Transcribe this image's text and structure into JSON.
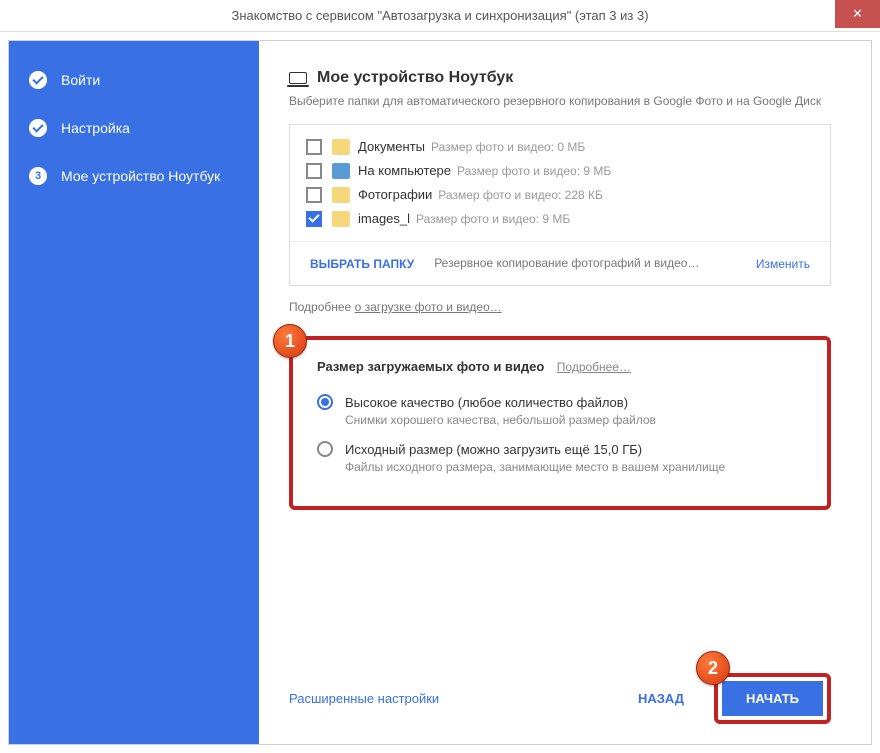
{
  "titlebar": {
    "text": "Знакомство с сервисом \"Автозагрузка и синхронизация\" (этап 3 из 3)",
    "close": "✕"
  },
  "sidebar": {
    "items": [
      {
        "label": "Войти",
        "type": "check"
      },
      {
        "label": "Настройка",
        "type": "check"
      },
      {
        "label": "Мое устройство Ноутбук",
        "type": "step",
        "num": "3"
      }
    ]
  },
  "main": {
    "device_title": "Мое устройство Ноутбук",
    "device_sub": "Выберите папки для автоматического резервного копирования в Google Фото и на Google Диск",
    "folders": [
      {
        "name": "Документы",
        "size": "Размер фото и видео: 0 МБ",
        "checked": false,
        "icon": "folder"
      },
      {
        "name": "На компьютере",
        "size": "Размер фото и видео: 9 МБ",
        "checked": false,
        "icon": "pc"
      },
      {
        "name": "Фотографии",
        "size": "Размер фото и видео: 228 КБ",
        "checked": false,
        "icon": "folder"
      },
      {
        "name": "images_l",
        "size": "Размер фото и видео: 9 МБ",
        "checked": true,
        "icon": "folder"
      }
    ],
    "choose_folder": "ВЫБРАТЬ ПАПКУ",
    "backup_text": "Резервное копирование фотографий и видео…",
    "change": "Изменить",
    "more_prefix": "Подробнее ",
    "more_link": "о загрузке фото и видео…"
  },
  "quality": {
    "title": "Размер загружаемых фото и видео",
    "more": "Подробнее…",
    "options": [
      {
        "label": "Высокое качество (любое количество файлов)",
        "desc": "Снимки хорошего качества, небольшой размер файлов",
        "selected": true
      },
      {
        "label": "Исходный размер (можно загрузить ещё 15,0 ГБ)",
        "desc": "Файлы исходного размера, занимающие место в вашем хранилище",
        "selected": false
      }
    ],
    "badge": "1"
  },
  "bottom": {
    "advanced": "Расширенные настройки",
    "back": "НАЗАД",
    "start": "НАЧАТЬ",
    "badge": "2"
  }
}
